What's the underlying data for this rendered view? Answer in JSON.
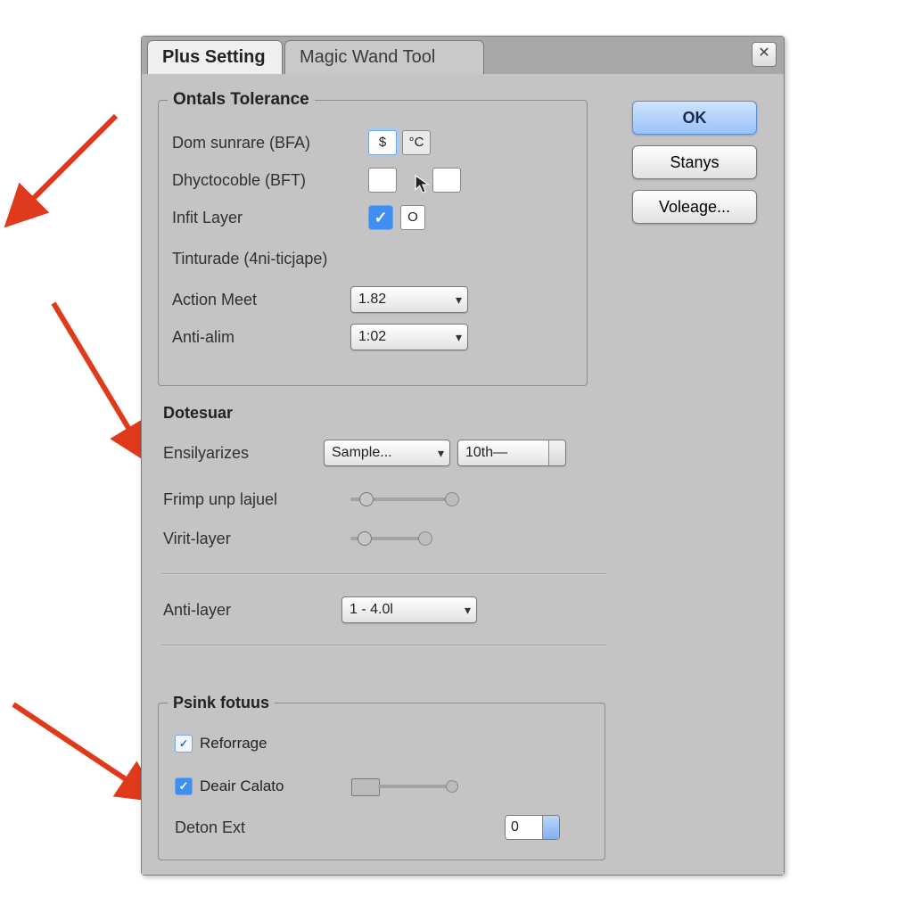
{
  "tabs": {
    "active": "Plus Setting",
    "inactive": "Magic Wand Tool"
  },
  "close_tooltip": "Close",
  "buttons": {
    "ok": "OK",
    "stanys": "Stanys",
    "voleage": "Voleage..."
  },
  "group1": {
    "legend": "Ontals Tolerance",
    "dom_sunrare_label": "Dom sunrare (BFA)",
    "dom_field1": "$",
    "dom_field2": "°C",
    "dhyctoble_label": "Dhyctocoble (BFT)",
    "infit_layer_label": "Infit Layer",
    "infit_side": "O",
    "tinturade_label": "Tinturade (4ni-ticjape)",
    "action_meet_label": "Action Meet",
    "action_meet_value": "1.82",
    "anti_alim_label": "Anti-alim",
    "anti_alim_value": "1:02"
  },
  "dotesuar": {
    "heading": "Dotesuar",
    "ensily_label": "Ensilyarizes",
    "ensily_value": "Sample...",
    "ensily_spin": "10th—",
    "frimp_label": "Frimp unp lajuel",
    "virit_label": "Virit-layer"
  },
  "anti_layer": {
    "label": "Anti-layer",
    "value": "1 - 4.0l"
  },
  "group2": {
    "legend": "Psink fotuus",
    "reforrage_label": "Reforrage",
    "deair_label": "Deair Calato",
    "deton_label": "Deton Ext",
    "deton_value": "0"
  }
}
